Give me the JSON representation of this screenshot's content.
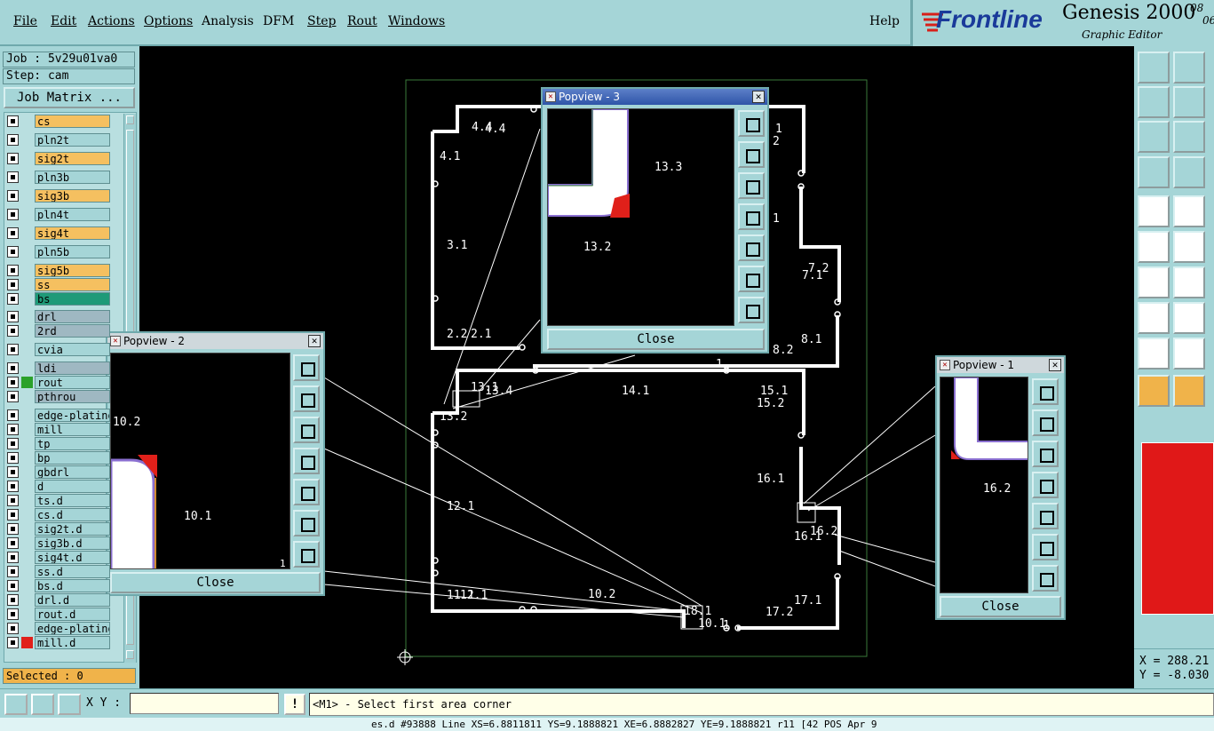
{
  "menu": {
    "items": [
      "File",
      "Edit",
      "Actions",
      "Options",
      "Analysis",
      "DFM",
      "Step",
      "Rout",
      "Windows"
    ],
    "help": "Help"
  },
  "brand": {
    "logo": "Frontline",
    "product": "Genesis 2000",
    "subtitle": "Graphic Editor",
    "date_frag1": "08",
    "date_frag2": "06"
  },
  "job": {
    "job_label": "Job : 5v29u01va0",
    "step_label": "Step: cam",
    "matrix_button": "Job Matrix ..."
  },
  "layers": [
    {
      "name": "cs",
      "bg": "#f5c060",
      "color": ""
    },
    {
      "name": "pln2t",
      "bg": "#a5d5d7",
      "color": ""
    },
    {
      "name": "sig2t",
      "bg": "#f5c060",
      "color": ""
    },
    {
      "name": "pln3b",
      "bg": "#a5d5d7",
      "color": ""
    },
    {
      "name": "sig3b",
      "bg": "#f5c060",
      "color": ""
    },
    {
      "name": "pln4t",
      "bg": "#a5d5d7",
      "color": ""
    },
    {
      "name": "sig4t",
      "bg": "#f5c060",
      "color": ""
    },
    {
      "name": "pln5b",
      "bg": "#a5d5d7",
      "color": ""
    },
    {
      "name": "sig5b",
      "bg": "#f5c060",
      "color": ""
    },
    {
      "name": "ss",
      "bg": "#f5c060",
      "color": ""
    },
    {
      "name": "bs",
      "bg": "#1e9a78",
      "color": ""
    },
    {
      "name": "drl",
      "bg": "#9fb8c2",
      "color": ""
    },
    {
      "name": "2rd",
      "bg": "#9fb8c2",
      "color": ""
    },
    {
      "name": "cvia",
      "bg": "#a5d5d7",
      "color": ""
    },
    {
      "name": "ldi",
      "bg": "#9fb8c2",
      "color": ""
    },
    {
      "name": "rout",
      "bg": "#a5d5d7",
      "color": "#2aa12a"
    },
    {
      "name": "pthrou",
      "bg": "#9fb8c2",
      "color": ""
    },
    {
      "name": "edge-plating",
      "bg": "#a5d5d7",
      "color": ""
    },
    {
      "name": "mill",
      "bg": "#a5d5d7",
      "color": ""
    },
    {
      "name": "tp",
      "bg": "#a5d5d7",
      "color": ""
    },
    {
      "name": "bp",
      "bg": "#a5d5d7",
      "color": ""
    },
    {
      "name": "gbdrl",
      "bg": "#a5d5d7",
      "color": ""
    },
    {
      "name": "d",
      "bg": "#a5d5d7",
      "color": ""
    },
    {
      "name": "ts.d",
      "bg": "#a5d5d7",
      "color": ""
    },
    {
      "name": "cs.d",
      "bg": "#a5d5d7",
      "color": ""
    },
    {
      "name": "sig2t.d",
      "bg": "#a5d5d7",
      "color": ""
    },
    {
      "name": "sig3b.d",
      "bg": "#a5d5d7",
      "color": ""
    },
    {
      "name": "sig4t.d",
      "bg": "#a5d5d7",
      "color": ""
    },
    {
      "name": "ss.d",
      "bg": "#a5d5d7",
      "color": ""
    },
    {
      "name": "bs.d",
      "bg": "#a5d5d7",
      "color": ""
    },
    {
      "name": "drl.d",
      "bg": "#a5d5d7",
      "color": ""
    },
    {
      "name": "rout.d",
      "bg": "#a5d5d7",
      "color": ""
    },
    {
      "name": "edge-plating",
      "bg": "#a5d5d7",
      "color": ""
    },
    {
      "name": "mill.d",
      "bg": "#a5d5d7",
      "color": "#e0201a"
    }
  ],
  "selected": "Selected : 0",
  "popup3": {
    "title": "Popview - 3",
    "labels": [
      "13.3",
      "13.2"
    ],
    "close": "Close"
  },
  "popup2": {
    "title": "Popview - 2",
    "labels": [
      "10.2",
      "10.1",
      "1"
    ],
    "close": "Close"
  },
  "popup1": {
    "title": "Popview - 1",
    "labels": [
      "16.2"
    ],
    "close": "Close"
  },
  "canvas_labels": [
    "4.4",
    "4.4",
    "4.1",
    "3.1",
    "2.2",
    "2.1",
    "14.1",
    "15.1",
    "15.2",
    "13.1",
    "13.4",
    "13.2",
    "12.1",
    "11.1",
    "12.1",
    "10.2",
    "18.1",
    "10.1",
    "16.1",
    "16.2",
    "16.1",
    "17.1",
    "17.2",
    "8.1",
    "8.2",
    "7.2",
    "7.1",
    "1",
    "2",
    "1",
    "1",
    "1"
  ],
  "status": {
    "xy_label": "X Y :",
    "xy_value": "",
    "prompt": "<M1> - Select first area corner",
    "bottom": "es.d #93888 Line XS=6.8811811 YS=9.1888821 XE=6.8882827 YE=9.1888821 r11 [42 POS Apr 9"
  },
  "coords": {
    "x": "X = 288.21",
    "y": "Y = -8.030"
  }
}
